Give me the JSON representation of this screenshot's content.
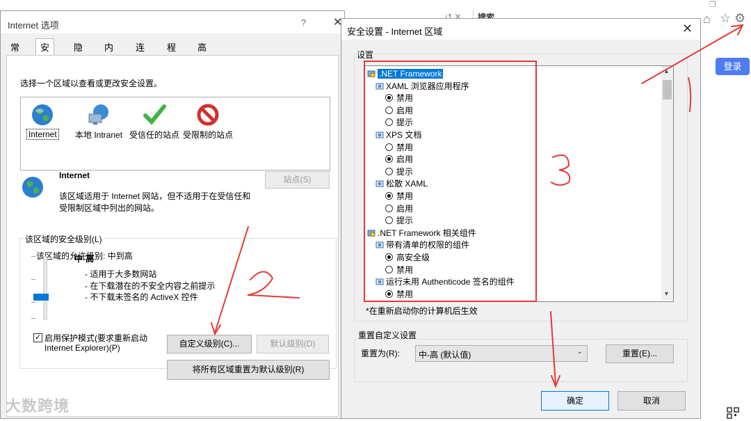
{
  "browser": {
    "search_label": "搜索",
    "login_label": "登录",
    "icons": [
      "home-icon",
      "star-icon",
      "gear-icon",
      "qr-code-icon"
    ]
  },
  "internet_options": {
    "title": "Internet 选项",
    "help": "?",
    "close": "✕",
    "tabs": [
      "常规",
      "安全",
      "隐私",
      "内容",
      "连接",
      "程序",
      "高级"
    ],
    "active_tab": "安全",
    "zone_instruction": "选择一个区域以查看或更改安全设置。",
    "zones": [
      {
        "label": "Internet",
        "icon": "globe-icon"
      },
      {
        "label": "本地 Intranet",
        "icon": "intranet-globe-icon"
      },
      {
        "label": "受信任的站点",
        "icon": "check-icon"
      },
      {
        "label": "受限制的站点",
        "icon": "prohibited-icon"
      }
    ],
    "selected_zone_title": "Internet",
    "selected_zone_desc_1": "该区域适用于 Internet 网站，但不适用于在受信任和",
    "selected_zone_desc_2": "受限制区域中列出的网站。",
    "sites_button": "站点(S)",
    "security_level_group": "该区域的安全级别(L)",
    "allowed_levels": "该区域的允许级别: 中到高",
    "level_name": "中-高",
    "level_bullets": [
      "- 适用于大多数网站",
      "- 在下载潜在的不安全内容之前提示",
      "- 不下载未签名的 ActiveX 控件"
    ],
    "protected_mode_line1": "启用保护模式(要求重新启动",
    "protected_mode_line2": "Internet Explorer)(P)",
    "protected_mode_checked": true,
    "custom_level_button": "自定义级别(C)...",
    "default_level_button": "默认级别(D)",
    "reset_all_button": "将所有区域重置为默认级别(R)"
  },
  "security_settings": {
    "title": "安全设置 - Internet 区域",
    "close": "✕",
    "settings_label": "设置",
    "tree": [
      {
        "type": "category",
        "label": ".NET Framework",
        "selected": true
      },
      {
        "type": "setting",
        "label": "XAML 浏览器应用程序"
      },
      {
        "type": "option",
        "label": "禁用",
        "checked": true
      },
      {
        "type": "option",
        "label": "启用",
        "checked": false
      },
      {
        "type": "option",
        "label": "提示",
        "checked": false
      },
      {
        "type": "setting",
        "label": "XPS 文档"
      },
      {
        "type": "option",
        "label": "禁用",
        "checked": false
      },
      {
        "type": "option",
        "label": "启用",
        "checked": true
      },
      {
        "type": "option",
        "label": "提示",
        "checked": false
      },
      {
        "type": "setting",
        "label": "松散 XAML"
      },
      {
        "type": "option",
        "label": "禁用",
        "checked": true
      },
      {
        "type": "option",
        "label": "启用",
        "checked": false
      },
      {
        "type": "option",
        "label": "提示",
        "checked": false
      },
      {
        "type": "category",
        "label": ".NET Framework 相关组件",
        "selected": false
      },
      {
        "type": "setting",
        "label": "带有清单的权限的组件"
      },
      {
        "type": "option",
        "label": "高安全级",
        "checked": true
      },
      {
        "type": "option",
        "label": "禁用",
        "checked": false
      },
      {
        "type": "setting",
        "label": "运行未用 Authenticode 签名的组件"
      },
      {
        "type": "option",
        "label": "禁用",
        "checked": true
      }
    ],
    "restart_note": "*在重新启动你的计算机后生效",
    "reset_group": "重置自定义设置",
    "reset_to_label": "重置为(R):",
    "reset_to_value": "中-高 (默认值)",
    "reset_button": "重置(E)...",
    "ok_button": "确定",
    "cancel_button": "取消"
  },
  "annotations": {
    "marks": [
      "1",
      "2",
      "3"
    ],
    "color": "#e53935"
  },
  "watermark": "大数跨境"
}
